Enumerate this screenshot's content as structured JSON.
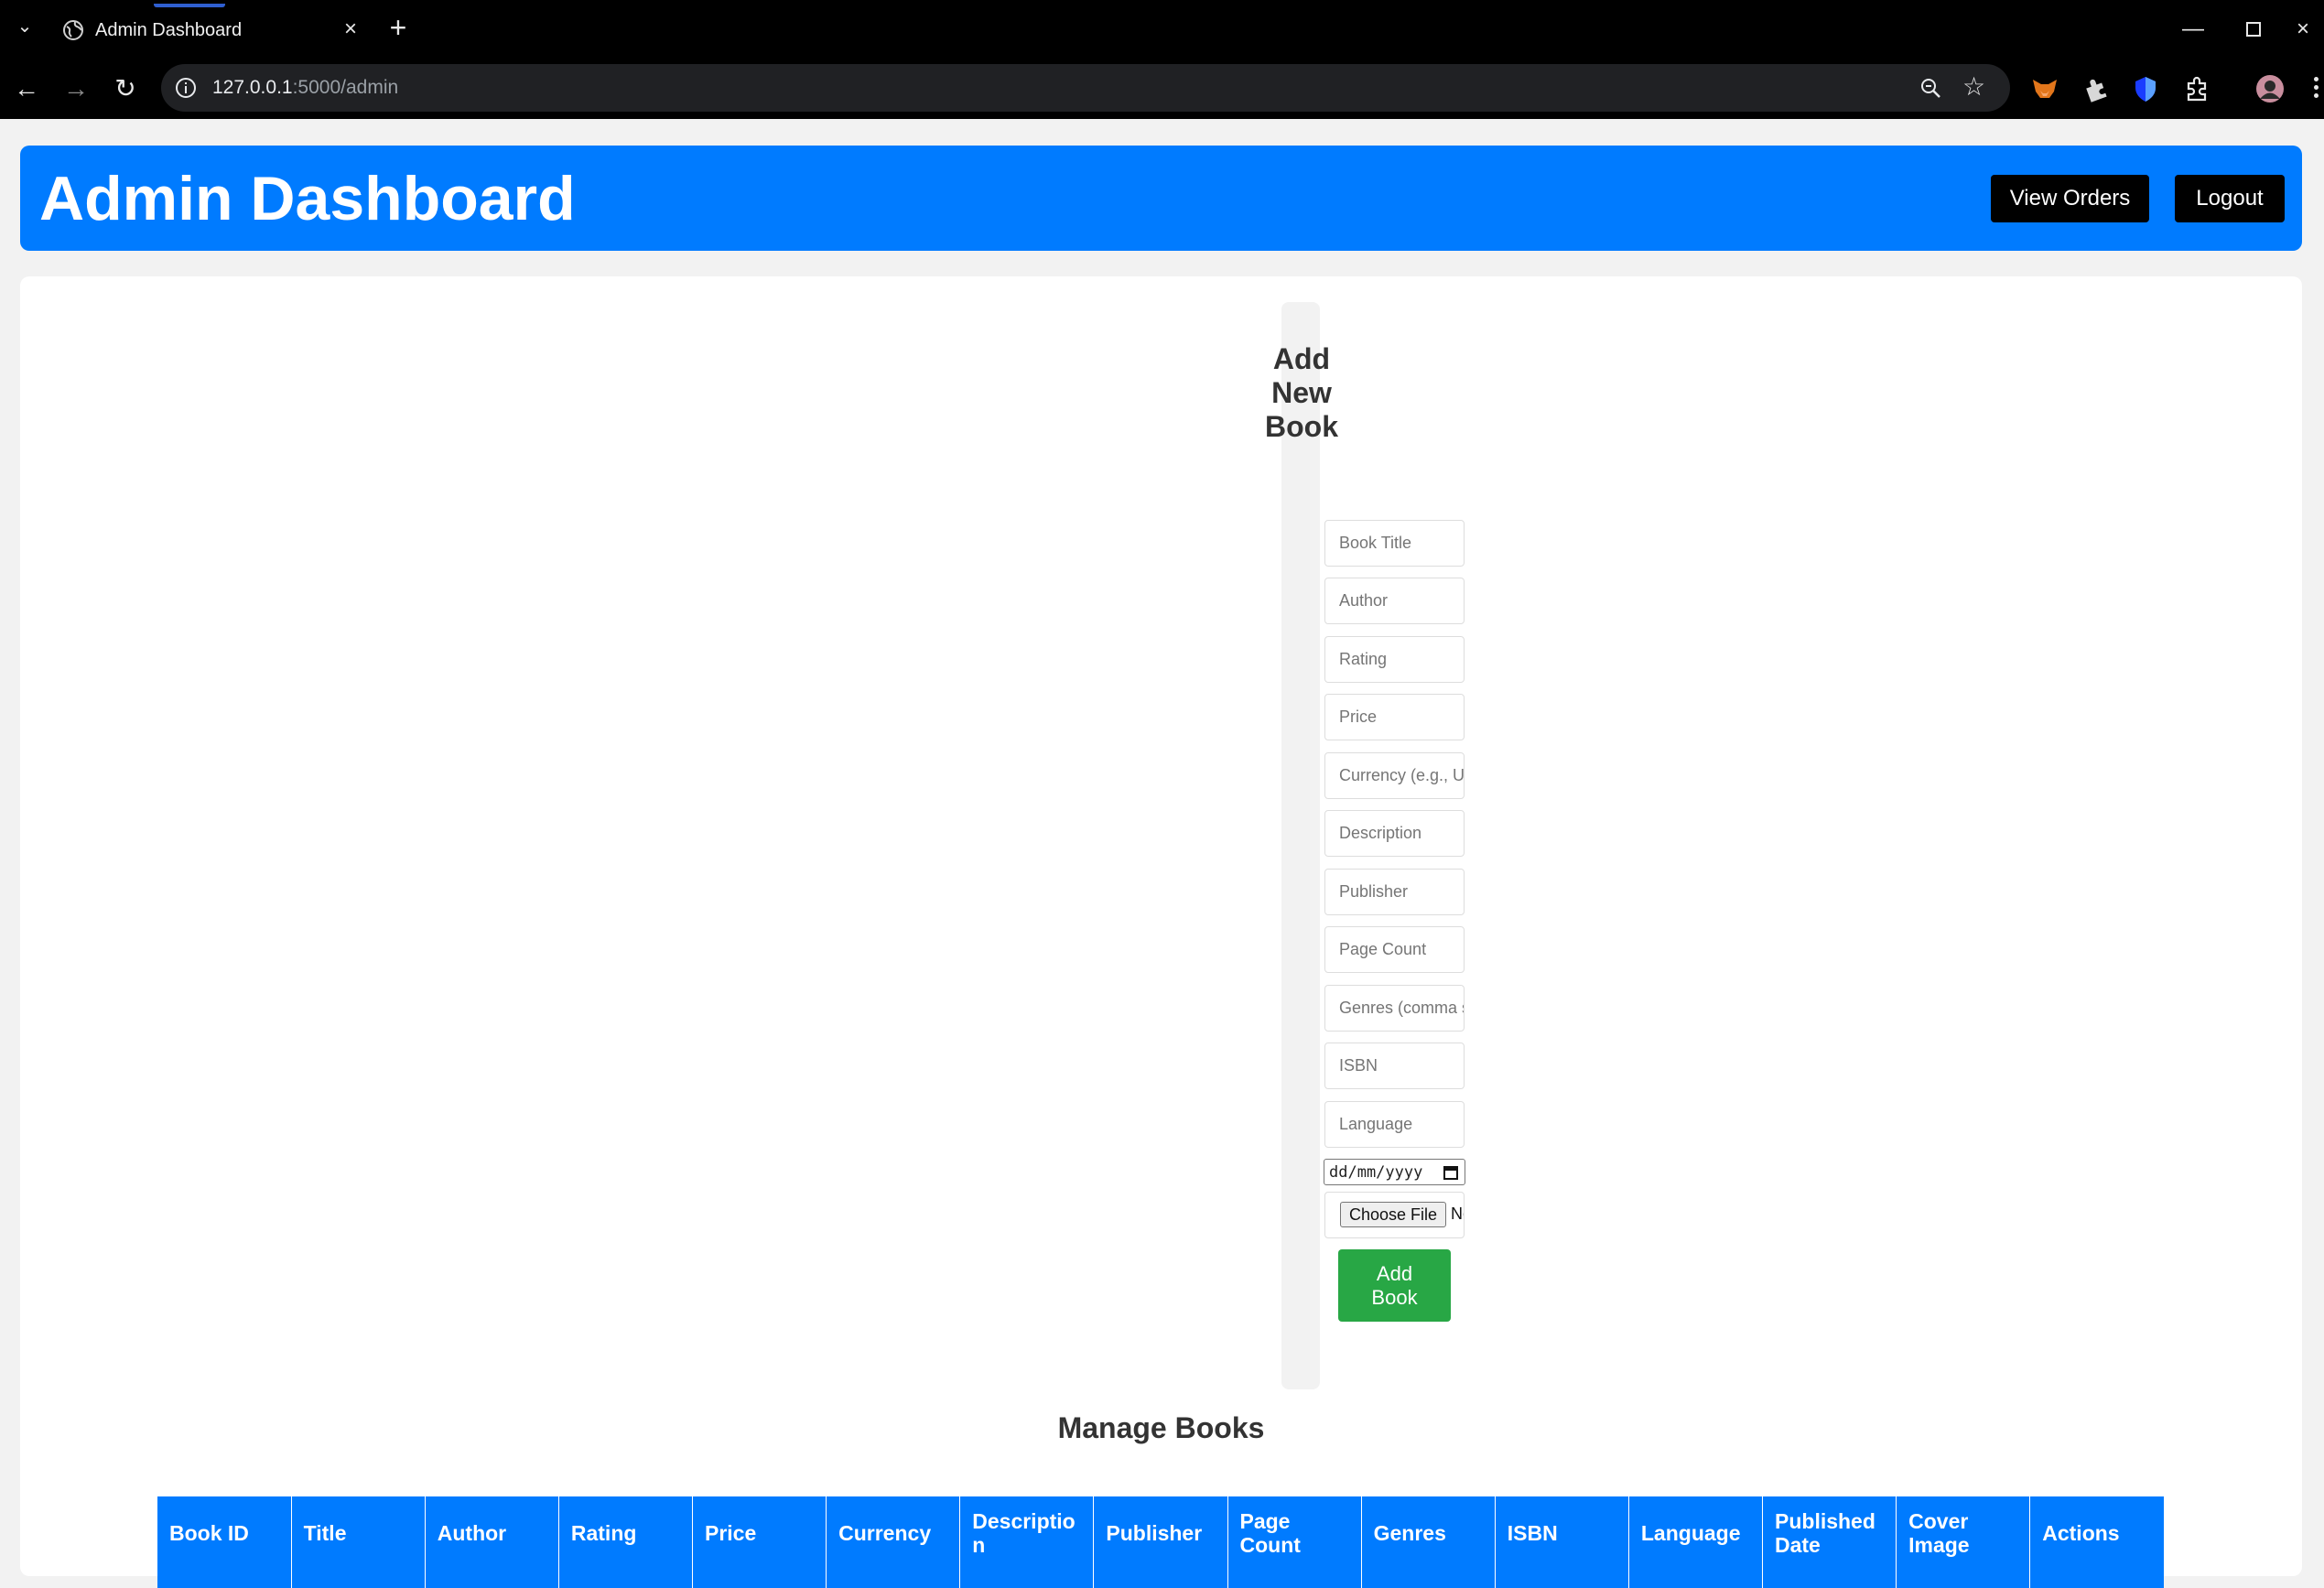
{
  "browser": {
    "tab_title": "Admin Dashboard",
    "url_host": "127.0.0.1",
    "url_path": ":5000/admin"
  },
  "header": {
    "title": "Admin Dashboard",
    "view_orders_label": "View Orders",
    "logout_label": "Logout"
  },
  "form": {
    "title_lines": [
      "Add",
      "New",
      "Book"
    ],
    "fields": {
      "book_title": "Book Title",
      "author": "Author",
      "rating": "Rating",
      "price": "Price",
      "currency": "Currency (e.g., USD)",
      "description": "Description",
      "publisher": "Publisher",
      "page_count": "Page Count",
      "genres": "Genres (comma separated)",
      "isbn": "ISBN",
      "language": "Language"
    },
    "date_placeholder": "dd/mm/yyyy",
    "file_button": "Choose File",
    "file_status": "No file chosen",
    "submit_line1": "Add",
    "submit_line2": "Book"
  },
  "manage": {
    "title": "Manage Books",
    "columns": [
      "Book ID",
      "Title",
      "Author",
      "Rating",
      "Price",
      "Currency",
      "Description",
      "Publisher",
      "Page Count",
      "Genres",
      "ISBN",
      "Language",
      "Published Date",
      "Cover Image",
      "Actions"
    ]
  },
  "colors": {
    "primary": "#007bff",
    "success": "#28a745",
    "dark_button": "#000000"
  }
}
